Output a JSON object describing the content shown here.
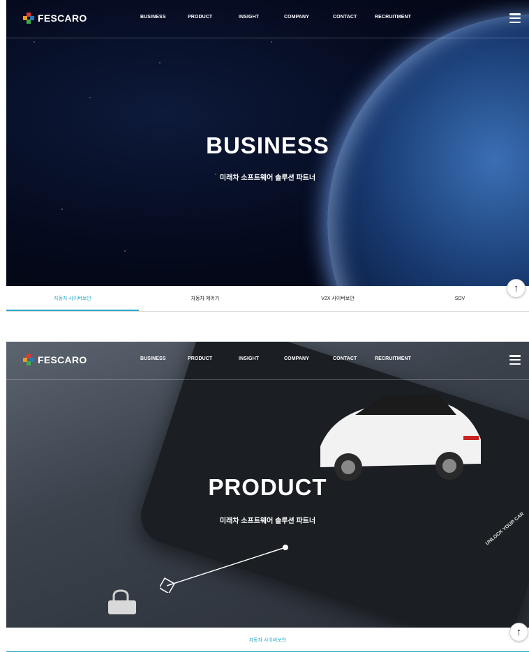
{
  "nav": {
    "logo_text": "FESCARO",
    "menu": [
      "BUSINESS",
      "PRODUCT",
      "INSIGHT",
      "COMPANY",
      "CONTACT",
      "RECRUITMENT"
    ]
  },
  "business": {
    "title": "BUSINESS",
    "subtitle": "미래차 소프트웨어 솔루션 파트너",
    "tabs": [
      "자동차 사이버보안",
      "자동차 제어기",
      "V2X 사이버보안",
      "SDV"
    ],
    "active_tab_index": 0
  },
  "product": {
    "title": "PRODUCT",
    "subtitle": "미래차 소프트웨어 솔루션 파트너",
    "tabs": [
      "자동차 사이버보안"
    ],
    "phone_caption": "UNLOCK YOUR CAR"
  },
  "top_button": {
    "icon": "arrow-up-icon",
    "glyph": "↑"
  },
  "colors": {
    "accent": "#2aa7c9",
    "logo_red": "#e23a2f",
    "logo_orange": "#f39a1e",
    "logo_green": "#3dae49",
    "logo_blue": "#1f7bc1"
  }
}
